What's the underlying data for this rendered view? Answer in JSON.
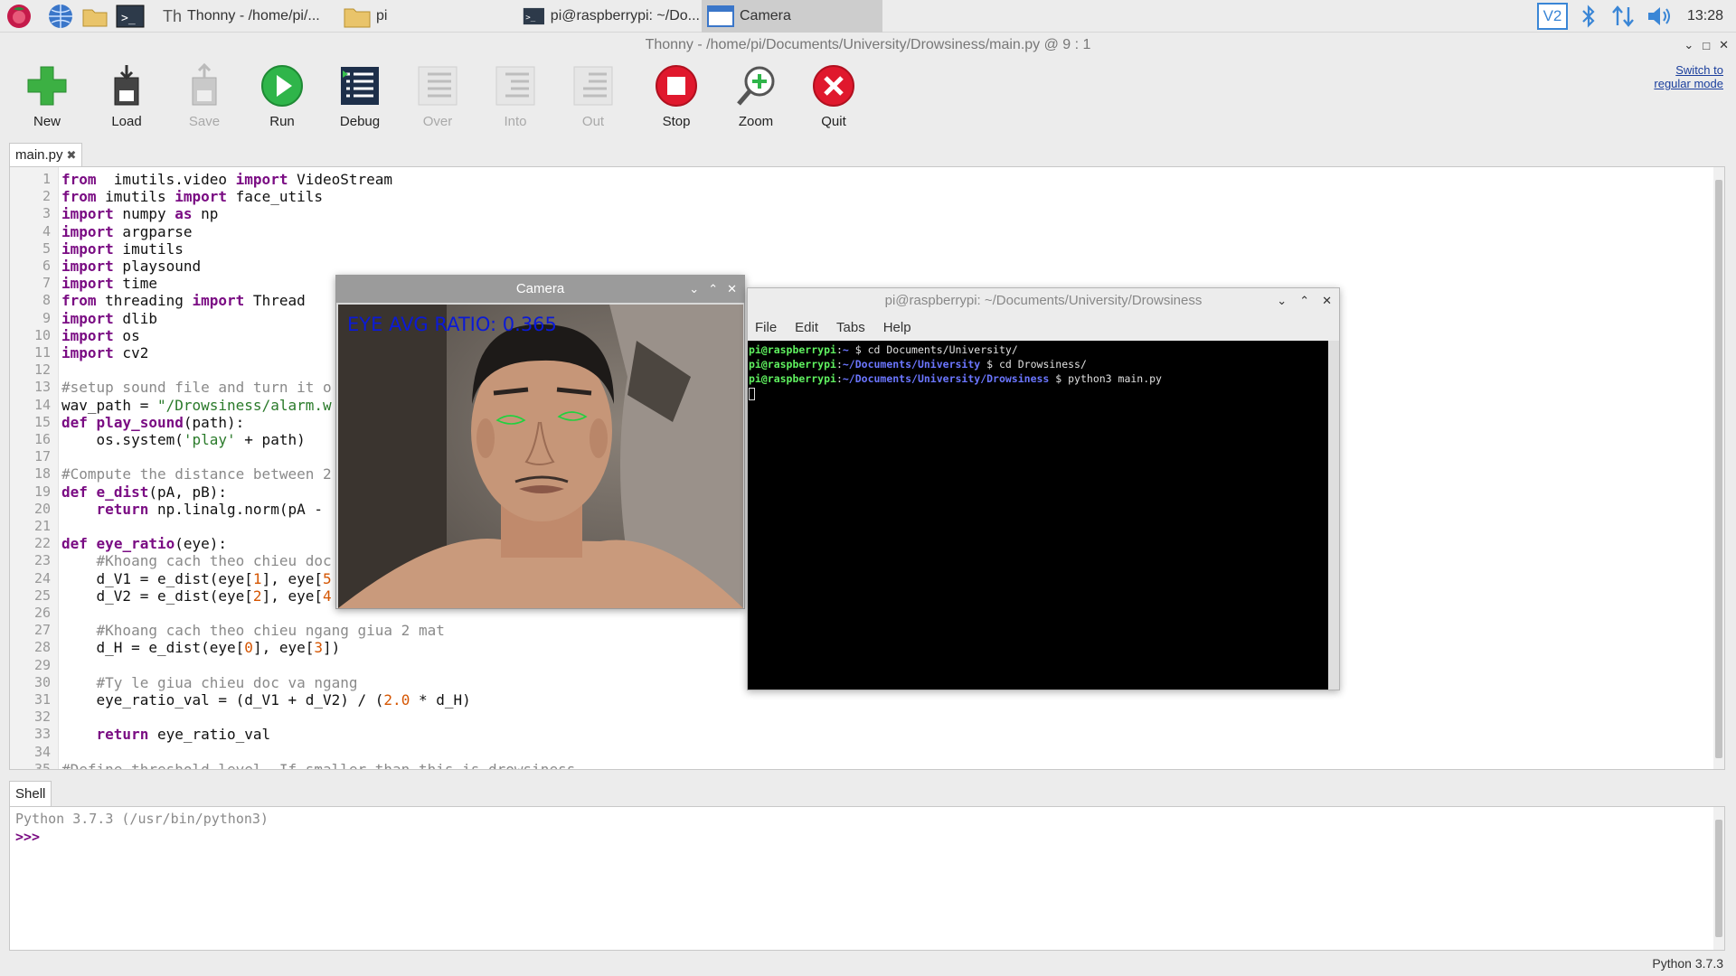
{
  "taskbar": {
    "tasks": [
      {
        "label": "Thonny  -  /home/pi/..."
      },
      {
        "label": "pi"
      },
      {
        "label": "pi@raspberrypi: ~/Do..."
      },
      {
        "label": "Camera"
      }
    ],
    "tray_vnc": "V2",
    "clock": "13:28"
  },
  "thonny": {
    "title": "Thonny  -  /home/pi/Documents/University/Drowsiness/main.py  @  9 : 1",
    "toolbar": {
      "new": "New",
      "load": "Load",
      "save": "Save",
      "run": "Run",
      "debug": "Debug",
      "over": "Over",
      "into": "Into",
      "out": "Out",
      "stop": "Stop",
      "zoom": "Zoom",
      "quit": "Quit"
    },
    "switch_mode_link": "Switch to regular mode",
    "editor_tab": "main.py",
    "line_numbers": [
      "1",
      "2",
      "3",
      "4",
      "5",
      "6",
      "7",
      "8",
      "9",
      "10",
      "11",
      "12",
      "13",
      "14",
      "15",
      "16",
      "17",
      "18",
      "19",
      "20",
      "21",
      "22",
      "23",
      "24",
      "25",
      "26",
      "27",
      "28",
      "29",
      "30",
      "31",
      "32",
      "33",
      "34",
      "35"
    ],
    "code": [
      {
        "parts": [
          [
            "kw",
            "from"
          ],
          [
            "",
            "  imutils.video "
          ],
          [
            "kw",
            "import"
          ],
          [
            "",
            " VideoStream"
          ]
        ]
      },
      {
        "parts": [
          [
            "kw",
            "from"
          ],
          [
            "",
            " imutils "
          ],
          [
            "kw",
            "import"
          ],
          [
            "",
            " face_utils"
          ]
        ]
      },
      {
        "parts": [
          [
            "kw",
            "import"
          ],
          [
            "",
            " numpy "
          ],
          [
            "kw",
            "as"
          ],
          [
            "",
            " np"
          ]
        ]
      },
      {
        "parts": [
          [
            "kw",
            "import"
          ],
          [
            "",
            " argparse"
          ]
        ]
      },
      {
        "parts": [
          [
            "kw",
            "import"
          ],
          [
            "",
            " imutils"
          ]
        ]
      },
      {
        "parts": [
          [
            "kw",
            "import"
          ],
          [
            "",
            " playsound"
          ]
        ]
      },
      {
        "parts": [
          [
            "kw",
            "import"
          ],
          [
            "",
            " time"
          ]
        ]
      },
      {
        "parts": [
          [
            "kw",
            "from"
          ],
          [
            "",
            " threading "
          ],
          [
            "kw",
            "import"
          ],
          [
            "",
            " Thread"
          ]
        ]
      },
      {
        "parts": [
          [
            "kw",
            "import"
          ],
          [
            "",
            " dlib"
          ]
        ]
      },
      {
        "parts": [
          [
            "kw",
            "import"
          ],
          [
            "",
            " os"
          ]
        ]
      },
      {
        "parts": [
          [
            "kw",
            "import"
          ],
          [
            "",
            " cv2"
          ]
        ]
      },
      {
        "parts": [
          [
            "",
            ""
          ]
        ]
      },
      {
        "parts": [
          [
            "cmt",
            "#setup sound file and turn it o"
          ]
        ]
      },
      {
        "parts": [
          [
            "",
            "wav_path = "
          ],
          [
            "str",
            "\"/Drowsiness/alarm.w"
          ]
        ]
      },
      {
        "parts": [
          [
            "kw",
            "def"
          ],
          [
            "",
            " "
          ],
          [
            "kw",
            "play_sound"
          ],
          [
            "",
            "(path):"
          ]
        ]
      },
      {
        "parts": [
          [
            "",
            "    os.system("
          ],
          [
            "str",
            "'play'"
          ],
          [
            "",
            " + path)"
          ]
        ]
      },
      {
        "parts": [
          [
            "",
            ""
          ]
        ]
      },
      {
        "parts": [
          [
            "cmt",
            "#Compute the distance between 2"
          ]
        ]
      },
      {
        "parts": [
          [
            "kw",
            "def"
          ],
          [
            "",
            " "
          ],
          [
            "kw",
            "e_dist"
          ],
          [
            "",
            "(pA, pB):"
          ]
        ]
      },
      {
        "parts": [
          [
            "",
            "    "
          ],
          [
            "kw",
            "return"
          ],
          [
            "",
            " np.linalg.norm(pA - "
          ]
        ]
      },
      {
        "parts": [
          [
            "",
            ""
          ]
        ]
      },
      {
        "parts": [
          [
            "kw",
            "def"
          ],
          [
            "",
            " "
          ],
          [
            "kw",
            "eye_ratio"
          ],
          [
            "",
            "(eye):"
          ]
        ]
      },
      {
        "parts": [
          [
            "cmt",
            "    #Khoang cach theo chieu doc"
          ]
        ]
      },
      {
        "parts": [
          [
            "",
            "    d_V1 = e_dist(eye["
          ],
          [
            "num",
            "1"
          ],
          [
            "",
            "], eye["
          ],
          [
            "num",
            "5"
          ]
        ]
      },
      {
        "parts": [
          [
            "",
            "    d_V2 = e_dist(eye["
          ],
          [
            "num",
            "2"
          ],
          [
            "",
            "], eye["
          ],
          [
            "num",
            "4"
          ]
        ]
      },
      {
        "parts": [
          [
            "",
            ""
          ]
        ]
      },
      {
        "parts": [
          [
            "cmt",
            "    #Khoang cach theo chieu ngang giua 2 mat"
          ]
        ]
      },
      {
        "parts": [
          [
            "",
            "    d_H = e_dist(eye["
          ],
          [
            "num",
            "0"
          ],
          [
            "",
            "], eye["
          ],
          [
            "num",
            "3"
          ],
          [
            "",
            "])"
          ]
        ]
      },
      {
        "parts": [
          [
            "",
            ""
          ]
        ]
      },
      {
        "parts": [
          [
            "cmt",
            "    #Ty le giua chieu doc va ngang"
          ]
        ]
      },
      {
        "parts": [
          [
            "",
            "    eye_ratio_val = (d_V1 + d_V2) / ("
          ],
          [
            "num",
            "2.0"
          ],
          [
            "",
            " * d_H)"
          ]
        ]
      },
      {
        "parts": [
          [
            "",
            ""
          ]
        ]
      },
      {
        "parts": [
          [
            "",
            "    "
          ],
          [
            "kw",
            "return"
          ],
          [
            "",
            " eye_ratio_val"
          ]
        ]
      },
      {
        "parts": [
          [
            "",
            ""
          ]
        ]
      },
      {
        "parts": [
          [
            "cmt",
            "#Define threshold level. If smaller than this is drowsiness"
          ]
        ]
      }
    ],
    "shell_tab": "Shell",
    "shell_line1": "Python 3.7.3 (/usr/bin/python3)",
    "shell_prompt": ">>>",
    "status": "Python 3.7.3"
  },
  "camera": {
    "title": "Camera",
    "overlay": "EYE AVG RATIO: 0.365"
  },
  "terminal": {
    "title": "pi@raspberrypi: ~/Documents/University/Drowsiness",
    "menu": [
      "File",
      "Edit",
      "Tabs",
      "Help"
    ],
    "lines": [
      {
        "user": "pi@raspberrypi",
        "path": "~",
        "cmd": " $ cd Documents/University/"
      },
      {
        "user": "pi@raspberrypi",
        "path": "~/Documents/University",
        "cmd": " $ cd Drowsiness/"
      },
      {
        "user": "pi@raspberrypi",
        "path": "~/Documents/University/Drowsiness",
        "cmd": " $ python3 main.py"
      }
    ]
  }
}
